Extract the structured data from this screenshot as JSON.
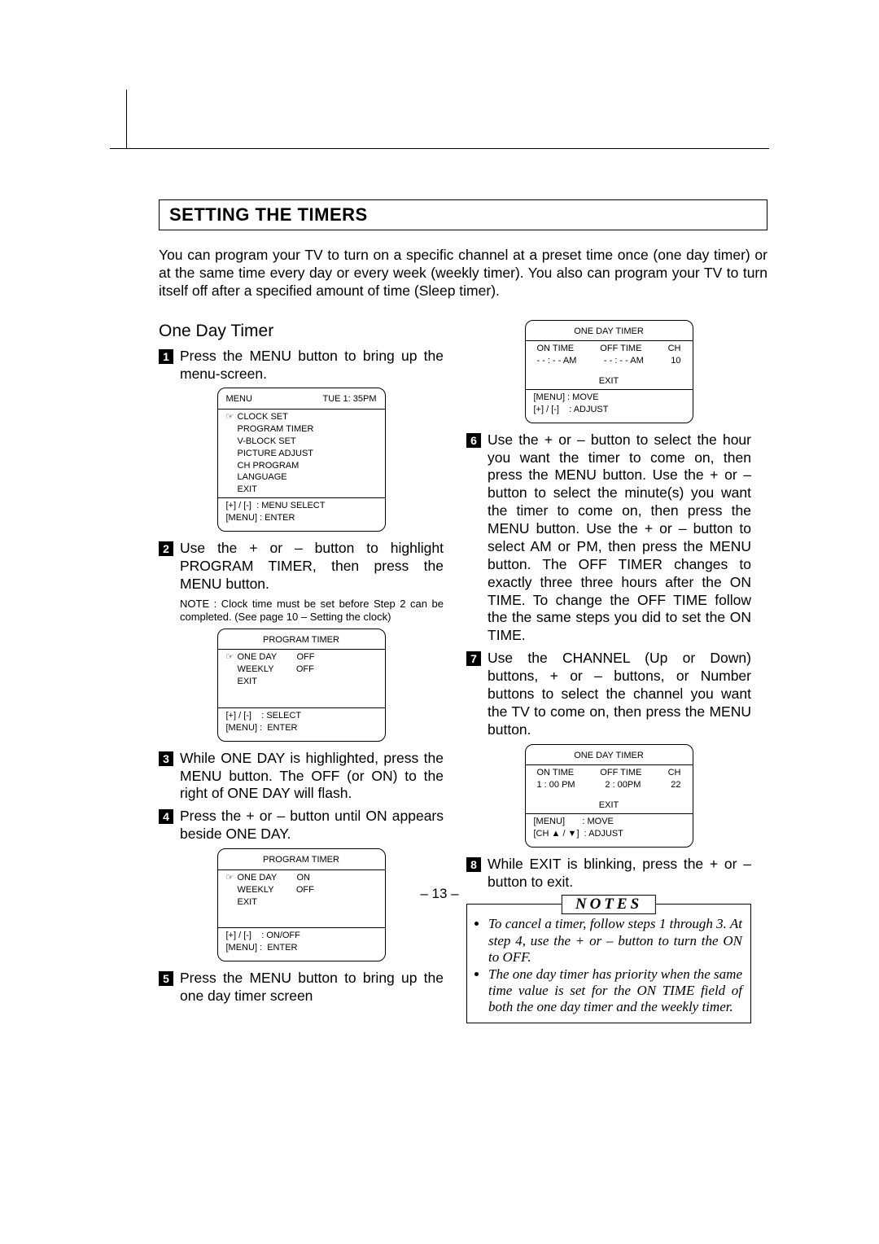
{
  "section_title": "SETTING THE TIMERS",
  "intro": "You can program your TV to turn on a specific channel at a preset time once (one day timer) or at the same time every day or every week (weekly timer). You also can program your TV to turn itself off after a specified amount of time (Sleep timer).",
  "subhead": "One Day Timer",
  "steps": {
    "s1": "Press the MENU button to bring up the menu-screen.",
    "s2": "Use the + or – button to highlight PROGRAM TIMER, then press the MENU button.",
    "s2_note": "NOTE : Clock time must be set before Step 2 can be completed. (See page 10 – Setting the clock)",
    "s3": "While ONE DAY is highlighted, press the MENU button. The OFF (or ON) to the right of ONE DAY will flash.",
    "s4": "Press the + or – button until ON appears beside ONE DAY.",
    "s5": "Press the MENU button to bring up the one day timer screen",
    "s6": "Use the + or – button to select the hour you want the timer to come on, then press the MENU button. Use the + or – button to select the minute(s) you want the timer to come on, then press the MENU button. Use the + or – button to select AM or PM, then press the MENU button. The OFF TIMER changes to exactly three three hours after the ON TIME. To change the OFF TIME follow the the same steps you did to set the ON TIME.",
    "s7": "Use the CHANNEL (Up or Down) buttons, + or – buttons, or Number buttons to select the channel you want the TV to come on, then press the MENU button.",
    "s8": "While EXIT is blinking, press the + or – button to exit."
  },
  "osd_menu": {
    "hdr_left": "MENU",
    "hdr_right": "TUE 1: 35PM",
    "items": [
      "CLOCK SET",
      "PROGRAM TIMER",
      "V-BLOCK SET",
      "PICTURE ADJUST",
      "CH PROGRAM",
      "LANGUAGE",
      "EXIT"
    ],
    "ctrl1": "[+] / [-]  : MENU SELECT",
    "ctrl2": "[MENU] : ENTER"
  },
  "osd_ptimer_off": {
    "title": "PROGRAM TIMER",
    "row1_l": "ONE DAY",
    "row1_r": "OFF",
    "row2_l": "WEEKLY",
    "row2_r": "OFF",
    "row3": "EXIT",
    "ctrl1": "[+] / [-]    : SELECT",
    "ctrl2": "[MENU] :  ENTER"
  },
  "osd_ptimer_on": {
    "title": "PROGRAM TIMER",
    "row1_l": "ONE DAY",
    "row1_r": "ON",
    "row2_l": "WEEKLY",
    "row2_r": "OFF",
    "row3": "EXIT",
    "ctrl1": "[+] / [-]    : ON/OFF",
    "ctrl2": "[MENU] :  ENTER"
  },
  "osd_oneday_blank": {
    "title": "ONE DAY TIMER",
    "col1_h": "ON TIME",
    "col2_h": "OFF TIME",
    "col3_h": "CH",
    "col1_v": "- - : - - AM",
    "col2_v": "- - : - - AM",
    "col3_v": "10",
    "exit": "EXIT",
    "ctrl1": "[MENU] : MOVE",
    "ctrl2": "[+] / [-]    : ADJUST"
  },
  "osd_oneday_set": {
    "title": "ONE DAY TIMER",
    "col1_h": "ON TIME",
    "col2_h": "OFF TIME",
    "col3_h": "CH",
    "col1_v": "1 : 00 PM",
    "col2_v": "2 : 00PM",
    "col3_v": "22",
    "exit": "EXIT",
    "ctrl1": "[MENU]       : MOVE",
    "ctrl2": "[CH ▲ / ▼]  : ADJUST"
  },
  "notes": {
    "title": "NOTES",
    "n1": "To cancel a timer, follow steps 1 through 3. At step 4, use the + or – button to turn the ON to OFF.",
    "n2": "The one day timer has priority when the same time value is set for the ON TIME field of both the one day timer and the weekly timer."
  },
  "page_number": "– 13 –"
}
